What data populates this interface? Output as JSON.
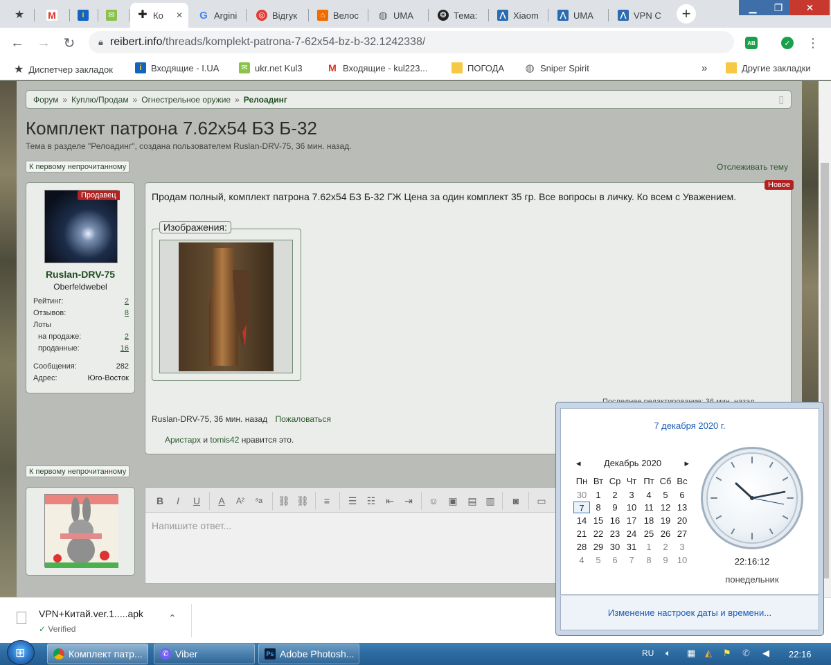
{
  "browser": {
    "tabs": [
      {
        "label": "",
        "icon": "star-icon"
      },
      {
        "label": "",
        "icon": "gmail-icon"
      },
      {
        "label": "",
        "icon": "i-ua-icon"
      },
      {
        "label": "",
        "icon": "ukrnet-icon"
      },
      {
        "label": "Ко",
        "icon": "cross-icon",
        "active": true
      },
      {
        "label": "Argini",
        "icon": "google-icon"
      },
      {
        "label": "Відгук",
        "icon": "target-icon"
      },
      {
        "label": "Велос",
        "icon": "home-icon"
      },
      {
        "label": "UMA",
        "icon": "globe-icon"
      },
      {
        "label": "Тема:",
        "icon": "film-icon"
      },
      {
        "label": "Xiaom",
        "icon": "wave-icon"
      },
      {
        "label": "UMA",
        "icon": "wave-icon"
      },
      {
        "label": "VPN C",
        "icon": "wave-icon"
      }
    ],
    "url": {
      "domain": "reibert.info",
      "path": "/threads/komplekt-patrona-7-62x54-bz-b-32.1242338/"
    },
    "bookmarks": [
      {
        "label": "Диспетчер закладок",
        "icon": "star-icon"
      },
      {
        "label": "Входящие - I.UA",
        "icon": "i-ua-icon"
      },
      {
        "label": "ukr.net  Kul3",
        "icon": "ukrnet-icon"
      },
      {
        "label": "Входящие - kul223...",
        "icon": "gmail-icon"
      },
      {
        "label": "ПОГОДА",
        "icon": "folder-icon"
      },
      {
        "label": "Sniper Spirit",
        "icon": "globe-icon"
      },
      {
        "label": "»",
        "icon": ""
      },
      {
        "label": "Другие закладки",
        "icon": "folder-icon"
      }
    ],
    "extensions": {
      "adblock": "AB"
    }
  },
  "page": {
    "breadcrumb": [
      "Форум",
      "Куплю/Продам",
      "Огнестрельное оружие",
      "Релоадинг"
    ],
    "breadcrumb_sep": "»",
    "title": "Комплект патрона 7.62x54 БЗ Б-32",
    "subtitle": "Тема в разделе \"Релоадинг\", создана пользователем Ruslan-DRV-75, 36 мин. назад.",
    "first_unread": "К первому непрочитанному",
    "follow": "Отслеживать тему",
    "user": {
      "seller_badge": "Продавец",
      "name": "Ruslan-DRV-75",
      "rank": "Oberfeldwebel",
      "stats": [
        {
          "label": "Рейтинг:",
          "value": "2"
        },
        {
          "label": "Отзывов:",
          "value": "8"
        },
        {
          "label": "Лоты",
          "value": ""
        },
        {
          "label": "на продаже:",
          "value": "2"
        },
        {
          "label": "проданные:",
          "value": "16"
        },
        {
          "label": "Сообщения:",
          "value": "282"
        },
        {
          "label": "Адрес:",
          "value": "Юго-Восток"
        }
      ]
    },
    "post": {
      "new_badge": "Новое",
      "text": "Продам полный, комплект патрона 7.62x54 БЗ Б-32 ГЖ Цена за один комплект 35 гр. Все вопросы в личку. Ко всем с Уважением.",
      "images_legend": "Изображения:",
      "author": "Ruslan-DRV-75, 36 мин. назад",
      "report": "Пожаловаться",
      "likes_users": [
        "Аристарх",
        "tomis42"
      ],
      "likes_and": "и",
      "likes_suffix": "нравится это.",
      "last_edit": "Последнее редактирование: 36 мин. назад"
    },
    "reply": {
      "placeholder": "Напишите ответ..."
    }
  },
  "download": {
    "name": "VPN+Китай.ver.1.....apk",
    "status": "Verified"
  },
  "calendar": {
    "full_date": "7 декабря 2020 г.",
    "month": "Декабрь 2020",
    "weekdays": [
      "Пн",
      "Вт",
      "Ср",
      "Чт",
      "Пт",
      "Сб",
      "Вс"
    ],
    "weeks": [
      [
        "30",
        "1",
        "2",
        "3",
        "4",
        "5",
        "6"
      ],
      [
        "7",
        "8",
        "9",
        "10",
        "11",
        "12",
        "13"
      ],
      [
        "14",
        "15",
        "16",
        "17",
        "18",
        "19",
        "20"
      ],
      [
        "21",
        "22",
        "23",
        "24",
        "25",
        "26",
        "27"
      ],
      [
        "28",
        "29",
        "30",
        "31",
        "1",
        "2",
        "3"
      ],
      [
        "4",
        "5",
        "6",
        "7",
        "8",
        "9",
        "10"
      ]
    ],
    "today": "7",
    "time": "22:16:12",
    "weekday": "понедельник",
    "settings_link": "Изменение настроек даты и времени..."
  },
  "taskbar": {
    "buttons": [
      {
        "label": "Комплект патр...",
        "icon": "chrome-icon"
      },
      {
        "label": "Viber",
        "icon": "viber-icon"
      },
      {
        "label": "Adobe Photosh...",
        "icon": "photoshop-icon"
      }
    ],
    "lang": "RU",
    "time": "22:16"
  },
  "colors": {
    "forum_green": "#2d5a2d",
    "badge_red": "#b22222",
    "link_blue": "#1a5bb5"
  }
}
